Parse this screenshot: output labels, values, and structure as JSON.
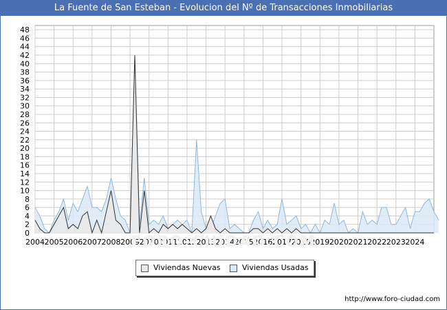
{
  "title": "La Fuente de San Esteban - Evolucion del Nº de Transacciones Inmobiliarias",
  "watermark": "FORO-CIUDAD.COM",
  "source": "http://www.foro-ciudad.com",
  "colors": {
    "title_bg": "#4a6fb3",
    "nuevas_fill": "#e8e8e8",
    "nuevas_line": "#333333",
    "usadas_fill": "#dbeaf7",
    "usadas_line": "#8fb8de",
    "grid": "#cccccc"
  },
  "chart_data": {
    "type": "area",
    "title": "La Fuente de San Esteban - Evolucion del Nº de Transacciones Inmobiliarias",
    "x_start": 2004.0,
    "x_step": 0.25,
    "xlim": [
      2004,
      2025
    ],
    "ylim": [
      0,
      49
    ],
    "yticks": [
      0,
      2,
      4,
      6,
      8,
      10,
      12,
      14,
      16,
      18,
      20,
      22,
      24,
      26,
      28,
      30,
      32,
      34,
      36,
      38,
      40,
      42,
      44,
      46,
      48
    ],
    "xticks": [
      "2004",
      "2005",
      "2006",
      "2007",
      "2008",
      "2009",
      "2010",
      "2011",
      "2012",
      "2013",
      "2014",
      "2015",
      "2016",
      "2017",
      "2018",
      "2019",
      "2020",
      "2021",
      "2022",
      "2023",
      "2024"
    ],
    "grid": true,
    "legend_position": "bottom",
    "series": [
      {
        "name": "Viviendas Nuevas",
        "color": "#e8e8e8",
        "values": [
          3,
          1,
          0,
          0,
          2,
          4,
          6,
          1,
          2,
          1,
          4,
          5,
          0,
          3,
          0,
          5,
          10,
          3,
          2,
          0,
          0,
          42,
          0,
          10,
          0,
          1,
          0,
          2,
          1,
          2,
          1,
          2,
          1,
          0,
          1,
          0,
          1,
          4,
          1,
          0,
          1,
          0,
          0,
          0,
          0,
          0,
          1,
          1,
          0,
          1,
          0,
          1,
          0,
          1,
          0,
          1,
          0,
          0,
          0,
          0,
          0,
          0,
          0,
          0,
          0,
          0,
          0,
          0,
          0,
          0,
          0,
          0,
          0,
          0,
          0,
          0,
          0,
          0,
          0,
          0,
          0,
          0,
          0,
          0,
          0
        ]
      },
      {
        "name": "Viviendas Usadas",
        "color": "#dbeaf7",
        "values": [
          6,
          4,
          1,
          0,
          3,
          5,
          8,
          3,
          7,
          5,
          8,
          11,
          6,
          6,
          5,
          8,
          13,
          8,
          4,
          3,
          0,
          42,
          2,
          13,
          2,
          3,
          2,
          4,
          1,
          2,
          3,
          2,
          3,
          0,
          22,
          5,
          1,
          1,
          4,
          7,
          8,
          1,
          2,
          1,
          0,
          0,
          3,
          5,
          1,
          3,
          1,
          2,
          8,
          2,
          3,
          4,
          1,
          2,
          0,
          2,
          0,
          3,
          2,
          7,
          2,
          3,
          0,
          1,
          0,
          5,
          2,
          3,
          2,
          6,
          6,
          2,
          2,
          4,
          6,
          1,
          5,
          5,
          7,
          8,
          5,
          3
        ]
      }
    ]
  }
}
